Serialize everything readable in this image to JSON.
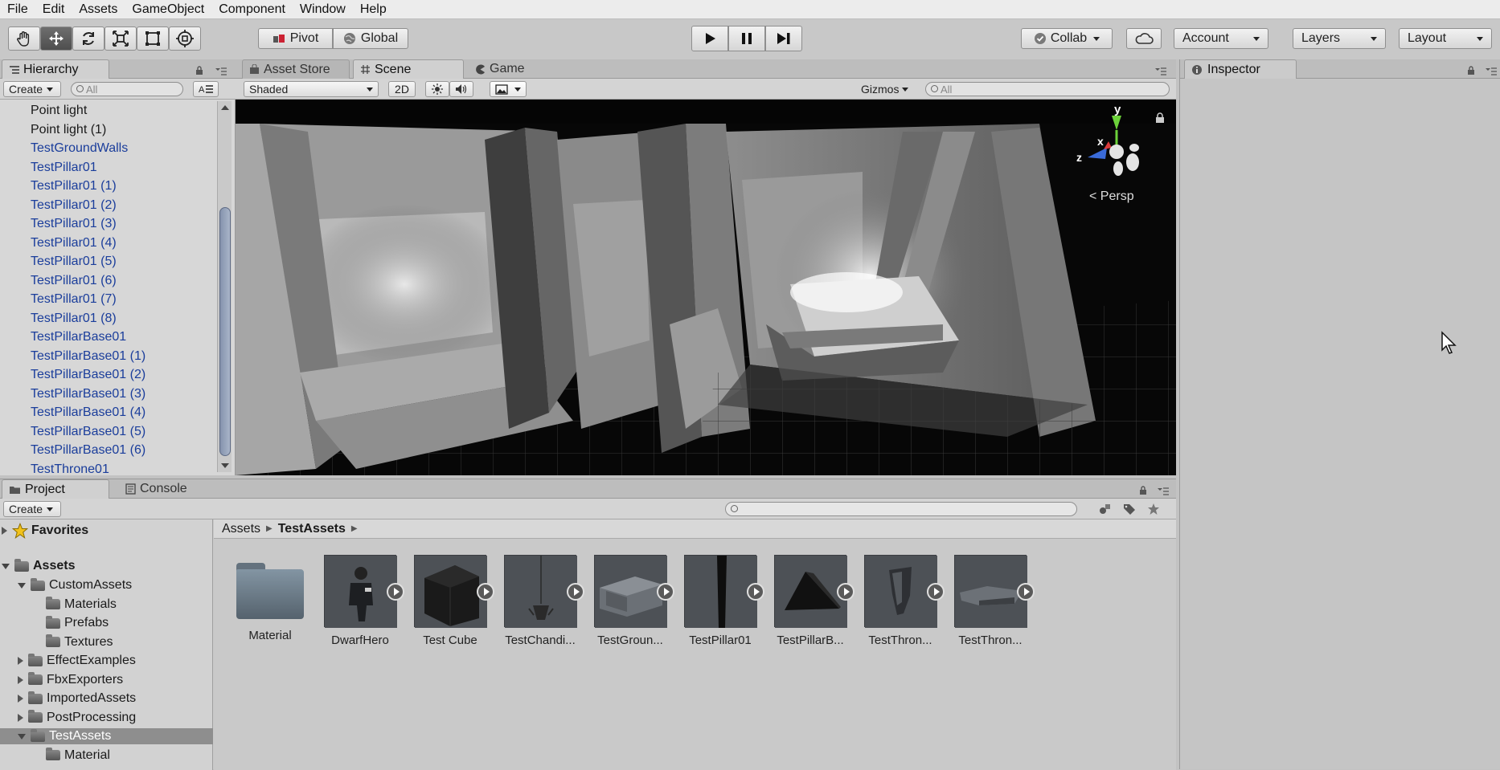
{
  "menu": [
    "File",
    "Edit",
    "Assets",
    "GameObject",
    "Component",
    "Window",
    "Help"
  ],
  "toolbar": {
    "pivot": "Pivot",
    "global": "Global",
    "collab": "Collab",
    "account": "Account",
    "layers": "Layers",
    "layout": "Layout"
  },
  "hierarchy": {
    "tab": "Hierarchy",
    "create": "Create",
    "search_placeholder": "All",
    "items": [
      {
        "label": "Point light",
        "prefab": false
      },
      {
        "label": "Point light (1)",
        "prefab": false
      },
      {
        "label": "TestGroundWalls",
        "prefab": true
      },
      {
        "label": "TestPillar01",
        "prefab": true
      },
      {
        "label": "TestPillar01 (1)",
        "prefab": true
      },
      {
        "label": "TestPillar01 (2)",
        "prefab": true
      },
      {
        "label": "TestPillar01 (3)",
        "prefab": true
      },
      {
        "label": "TestPillar01 (4)",
        "prefab": true
      },
      {
        "label": "TestPillar01 (5)",
        "prefab": true
      },
      {
        "label": "TestPillar01 (6)",
        "prefab": true
      },
      {
        "label": "TestPillar01 (7)",
        "prefab": true
      },
      {
        "label": "TestPillar01 (8)",
        "prefab": true
      },
      {
        "label": "TestPillarBase01",
        "prefab": true
      },
      {
        "label": "TestPillarBase01 (1)",
        "prefab": true
      },
      {
        "label": "TestPillarBase01 (2)",
        "prefab": true
      },
      {
        "label": "TestPillarBase01 (3)",
        "prefab": true
      },
      {
        "label": "TestPillarBase01 (4)",
        "prefab": true
      },
      {
        "label": "TestPillarBase01 (5)",
        "prefab": true
      },
      {
        "label": "TestPillarBase01 (6)",
        "prefab": true
      },
      {
        "label": "TestThrone01",
        "prefab": true
      }
    ]
  },
  "scene": {
    "tabs": [
      "Asset Store",
      "Scene",
      "Game"
    ],
    "shading": "Shaded",
    "mode_2d": "2D",
    "gizmos": "Gizmos",
    "search_placeholder": "All",
    "persp": "Persp",
    "axis_y": "y",
    "axis_x": "x",
    "axis_z": "z"
  },
  "inspector": {
    "tab": "Inspector"
  },
  "project": {
    "tabs": [
      "Project",
      "Console"
    ],
    "create": "Create",
    "favorites": "Favorites",
    "assets_root": "Assets",
    "tree": [
      {
        "label": "CustomAssets",
        "level": 1,
        "state": "open"
      },
      {
        "label": "Materials",
        "level": 2,
        "state": "none"
      },
      {
        "label": "Prefabs",
        "level": 2,
        "state": "none"
      },
      {
        "label": "Textures",
        "level": 2,
        "state": "none"
      },
      {
        "label": "EffectExamples",
        "level": 1,
        "state": "closed"
      },
      {
        "label": "FbxExporters",
        "level": 1,
        "state": "closed"
      },
      {
        "label": "ImportedAssets",
        "level": 1,
        "state": "closed"
      },
      {
        "label": "PostProcessing",
        "level": 1,
        "state": "closed"
      },
      {
        "label": "TestAssets",
        "level": 1,
        "state": "open",
        "selected": true
      },
      {
        "label": "Material",
        "level": 2,
        "state": "none"
      }
    ],
    "breadcrumb": [
      "Assets",
      "TestAssets"
    ],
    "assets": [
      {
        "label": "Material",
        "kind": "folder"
      },
      {
        "label": "DwarfHero",
        "kind": "model"
      },
      {
        "label": "Test Cube",
        "kind": "model"
      },
      {
        "label": "TestChandi...",
        "kind": "model"
      },
      {
        "label": "TestGroun...",
        "kind": "model"
      },
      {
        "label": "TestPillar01",
        "kind": "model"
      },
      {
        "label": "TestPillarB...",
        "kind": "model"
      },
      {
        "label": "TestThron...",
        "kind": "model"
      },
      {
        "label": "TestThron...",
        "kind": "model"
      }
    ]
  }
}
